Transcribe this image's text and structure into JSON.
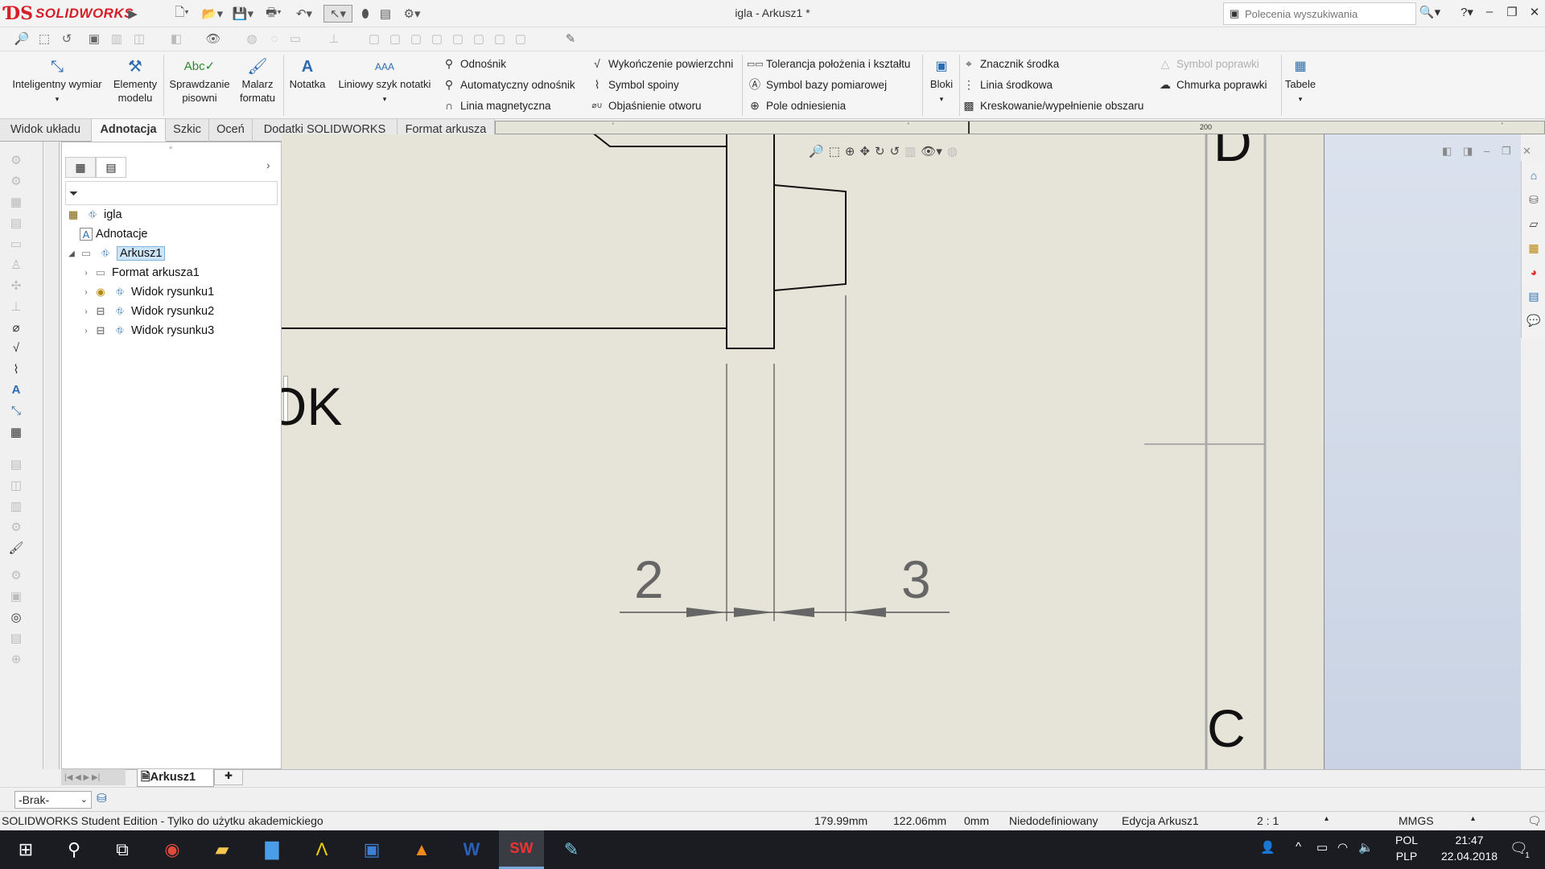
{
  "app": {
    "brand": "SOLIDWORKS",
    "window_title": "igla - Arkusz1 *",
    "search_placeholder": "Polecenia wyszukiwania"
  },
  "ribbon": {
    "big_buttons": [
      {
        "label": "Inteligentny wymiar",
        "icon": "smart-dimension-icon"
      },
      {
        "label": "Elementy modelu",
        "icon": "model-items-icon"
      },
      {
        "label": "Sprawdzanie pisowni",
        "icon": "spell-check-icon"
      },
      {
        "label": "Malarz formatu",
        "icon": "format-painter-icon"
      },
      {
        "label": "Notatka",
        "icon": "note-icon"
      },
      {
        "label": "Liniowy szyk notatki",
        "icon": "linear-note-pattern-icon"
      }
    ],
    "col1": [
      "Odnośnik",
      "Automatyczny odnośnik",
      "Linia magnetyczna"
    ],
    "col2": [
      "Wykończenie powierzchni",
      "Symbol spoiny",
      "Objaśnienie otworu"
    ],
    "col3": [
      "Tolerancja położenia i kształtu",
      "Symbol bazy pomiarowej",
      "Pole odniesienia"
    ],
    "blocks_label": "Bloki",
    "col4": [
      "Znacznik środka",
      "Linia środkowa",
      "Kreskowanie/wypełnienie obszaru"
    ],
    "col5": [
      "Symbol poprawki",
      "Chmurka poprawki"
    ],
    "tables_label": "Tabele"
  },
  "tabs": [
    "Widok układu",
    "Adnotacja",
    "Szkic",
    "Oceń",
    "Dodatki SOLIDWORKS",
    "Format arkusza"
  ],
  "active_tab": "Adnotacja",
  "ruler": {
    "mark": "200"
  },
  "tree": {
    "root": "igla",
    "items": [
      {
        "label": "Adnotacje",
        "indent": 1,
        "icon": "annotations-icon"
      },
      {
        "label": "Arkusz1",
        "indent": 1,
        "icon": "sheet-icon",
        "selected": true
      },
      {
        "label": "Format arkusza1",
        "indent": 2,
        "icon": "sheet-format-icon"
      },
      {
        "label": "Widok rysunku1",
        "indent": 2,
        "icon": "drawing-view-icon"
      },
      {
        "label": "Widok rysunku2",
        "indent": 2,
        "icon": "drawing-view-icon"
      },
      {
        "label": "Widok rysunku3",
        "indent": 2,
        "icon": "drawing-view-icon"
      }
    ]
  },
  "drawing": {
    "dim_left": "2",
    "dim_right": "3",
    "partial_text": "OK",
    "zone_top": "D",
    "zone_bottom": "C"
  },
  "sheet_tab": "Arkusz1",
  "layer": {
    "value": "-Brak-"
  },
  "status": {
    "edition": "SOLIDWORKS Student Edition - Tylko do użytku akademickiego",
    "x": "179.99mm",
    "y": "122.06mm",
    "z": "0mm",
    "state": "Niedodefiniowany",
    "editing": "Edycja Arkusz1",
    "scale": "2 : 1",
    "units": "MMGS"
  },
  "taskbar": {
    "lang1": "POL",
    "lang2": "PLP",
    "time": "21:47",
    "date": "22.04.2018",
    "notif_count": "1"
  }
}
